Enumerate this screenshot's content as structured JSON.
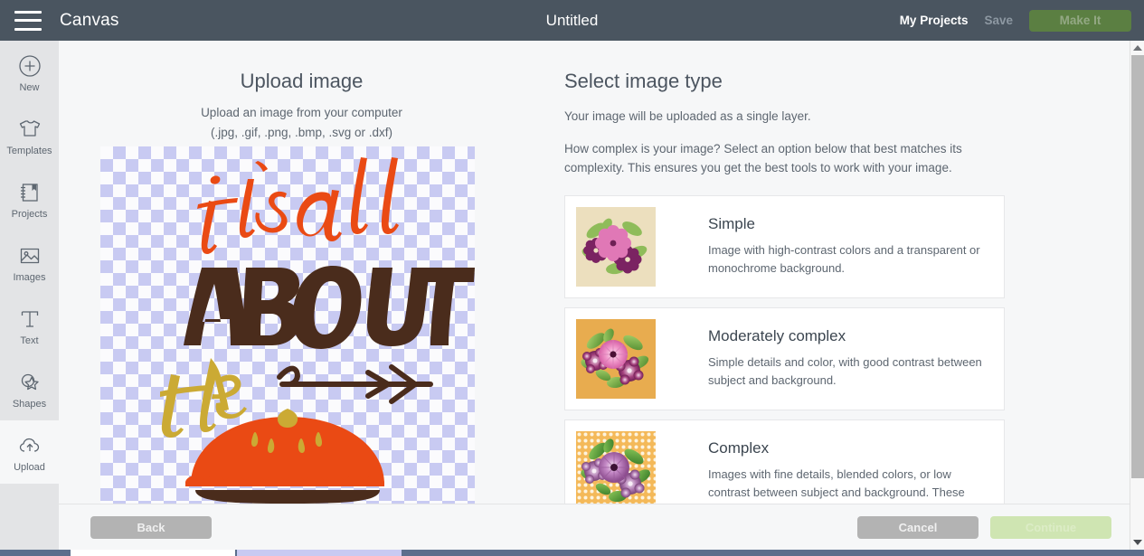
{
  "topbar": {
    "menu_icon": "hamburger-icon",
    "app_title": "Canvas",
    "document_title": "Untitled",
    "my_projects": "My Projects",
    "save": "Save",
    "make_it": "Make It",
    "make_it_color": "#5b7f42",
    "background_color": "#4a5560"
  },
  "sidebar": {
    "items": [
      {
        "label": "New",
        "icon": "plus-circle-icon",
        "active": false
      },
      {
        "label": "Templates",
        "icon": "tshirt-icon",
        "active": false
      },
      {
        "label": "Projects",
        "icon": "notebook-icon",
        "active": false
      },
      {
        "label": "Images",
        "icon": "picture-icon",
        "active": false
      },
      {
        "label": "Text",
        "icon": "text-t-icon",
        "active": false
      },
      {
        "label": "Shapes",
        "icon": "shapes-icon",
        "active": false
      },
      {
        "label": "Upload",
        "icon": "upload-cloud-icon",
        "active": true
      }
    ]
  },
  "upload_panel": {
    "heading": "Upload image",
    "subtitle": "Upload an image from your computer",
    "formats": "(.jpg, .gif, .png, .bmp, .svg or .dxf)",
    "preview_alt": "its-all-about-the-pie-artwork",
    "preview_text_line1": "it's all",
    "preview_text_line2": "ABOUT",
    "preview_text_line3": "the",
    "preview_colors": {
      "orange": "#ea4a14",
      "brown": "#4a2c1c",
      "gold": "#cbaa34",
      "checker": "#c8caf2"
    }
  },
  "image_type_panel": {
    "heading": "Select image type",
    "note": "Your image will be uploaded as a single layer.",
    "instruction": "How complex is your image? Select an option below that best matches its complexity. This ensures you get the best tools to work with your image.",
    "options": [
      {
        "title": "Simple",
        "description": "Image with high-contrast colors and a transparent or monochrome background.",
        "thumb_background": "#ecdfbe",
        "thumb_style": "flat"
      },
      {
        "title": "Moderately complex",
        "description": "Simple details and color, with good contrast between subject and background.",
        "thumb_background": "#e8ac4f",
        "thumb_style": "shaded"
      },
      {
        "title": "Complex",
        "description": "Images with fine details, blended colors, or low contrast between subject and background. These",
        "thumb_background": "#f4b959",
        "thumb_style": "dotted"
      }
    ]
  },
  "footer": {
    "back": "Back",
    "cancel": "Cancel",
    "continue": "Continue"
  },
  "scrollbar": {
    "up_arrow": "chevron-up-icon",
    "down_arrow": "chevron-down-icon"
  }
}
